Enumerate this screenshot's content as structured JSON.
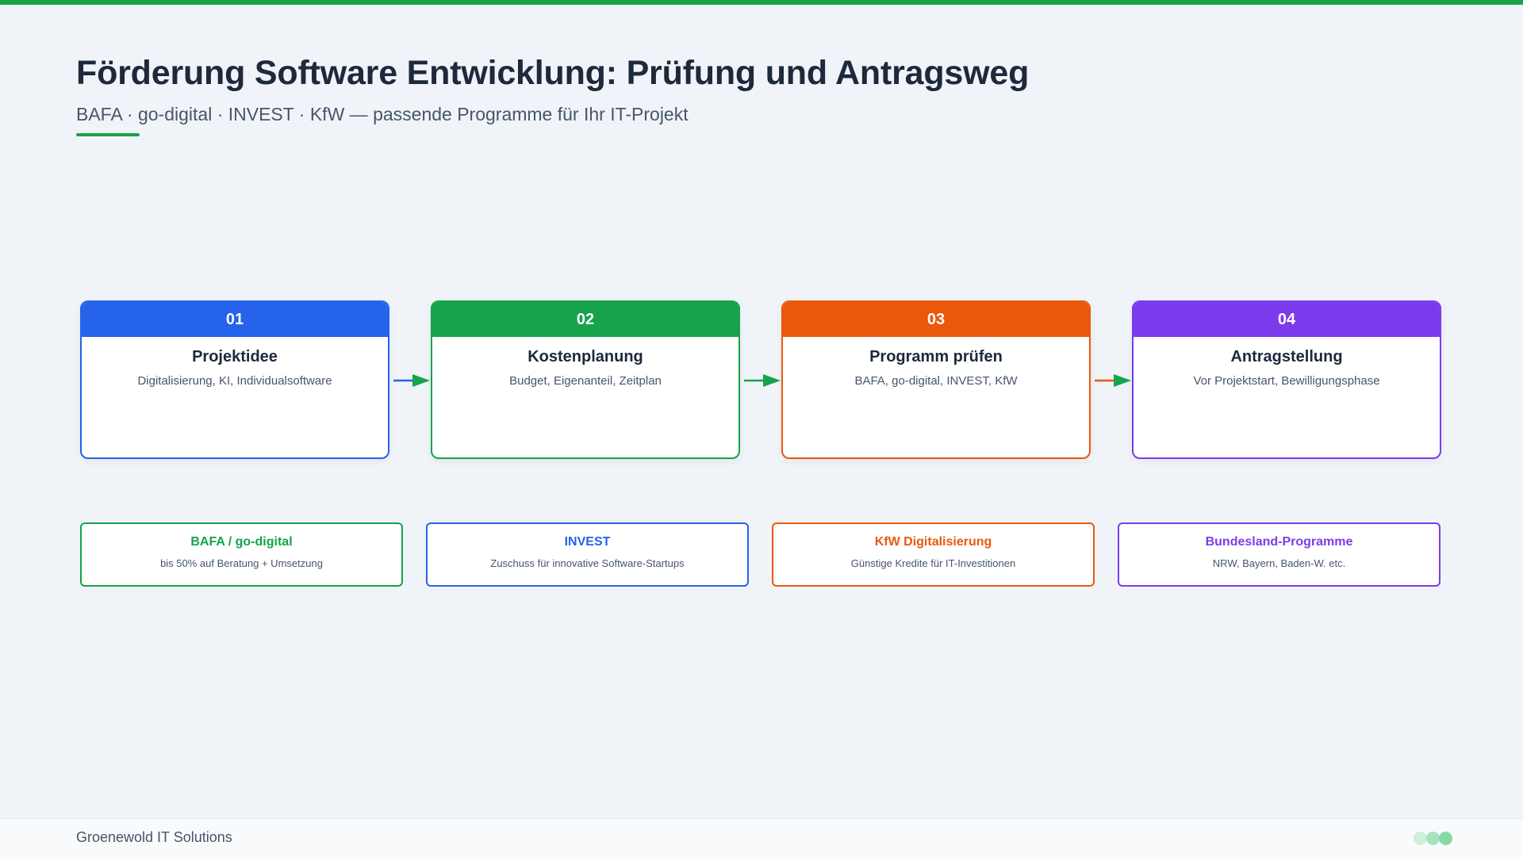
{
  "header": {
    "title": "Förderung Software Entwicklung: Prüfung und Antragsweg",
    "subtitle": "BAFA · go-digital · INVEST · KfW — passende Programme für Ihr IT-Projekt"
  },
  "colors": {
    "accent": "#16a34a",
    "blue": "#2563eb",
    "green": "#16a34a",
    "orange": "#ea580c",
    "purple": "#7c3aed"
  },
  "steps": [
    {
      "number": "01",
      "title": "Projektidee",
      "description": "Digitalisierung, KI, Individualsoftware",
      "color": "#2563eb"
    },
    {
      "number": "02",
      "title": "Kostenplanung",
      "description": "Budget, Eigenanteil, Zeitplan",
      "color": "#16a34a"
    },
    {
      "number": "03",
      "title": "Programm prüfen",
      "description": "BAFA, go-digital, INVEST, KfW",
      "color": "#ea580c"
    },
    {
      "number": "04",
      "title": "Antragstellung",
      "description": "Vor Projektstart, Bewilligungsphase",
      "color": "#7c3aed"
    }
  ],
  "arrows": [
    {
      "from": "01",
      "to": "02",
      "line_color": "#2563eb",
      "head_color": "#16a34a"
    },
    {
      "from": "02",
      "to": "03",
      "line_color": "#16a34a",
      "head_color": "#16a34a"
    },
    {
      "from": "03",
      "to": "04",
      "line_color": "#ea580c",
      "head_color": "#16a34a"
    }
  ],
  "programs": [
    {
      "title": "BAFA / go-digital",
      "description": "bis 50% auf Beratung + Umsetzung",
      "color": "#16a34a"
    },
    {
      "title": "INVEST",
      "description": "Zuschuss für innovative Software-Startups",
      "color": "#2563eb"
    },
    {
      "title": "KfW Digitalisierung",
      "description": "Günstige Kredite für IT-Investitionen",
      "color": "#ea580c"
    },
    {
      "title": "Bundesland-Programme",
      "description": "NRW, Bayern, Baden-W. etc.",
      "color": "#7c3aed"
    }
  ],
  "footer": {
    "company": "Groenewold IT Solutions",
    "dot_colors": [
      "#cfeedb",
      "#a7e3bd",
      "#86d8a4"
    ]
  }
}
